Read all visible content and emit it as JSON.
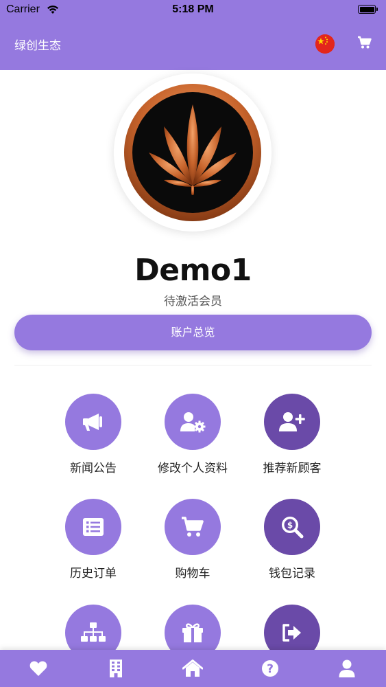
{
  "status_bar": {
    "carrier": "Carrier",
    "time": "5:18 PM"
  },
  "navbar": {
    "title": "绿创生态",
    "flag_icon": "china-flag-icon",
    "cart_icon": "cart-icon"
  },
  "profile": {
    "username": "Demo1",
    "status": "待激活会员",
    "overview_button": "账户总览"
  },
  "menu": [
    {
      "label": "新闻公告",
      "icon": "megaphone-icon"
    },
    {
      "label": "修改个人资料",
      "icon": "user-settings-icon"
    },
    {
      "label": "推荐新顾客",
      "icon": "add-user-icon"
    },
    {
      "label": "历史订单",
      "icon": "list-icon"
    },
    {
      "label": "购物车",
      "icon": "cart-icon"
    },
    {
      "label": "钱包记录",
      "icon": "search-dollar-icon"
    },
    {
      "label": "",
      "icon": "sitemap-icon"
    },
    {
      "label": "",
      "icon": "gift-icon"
    },
    {
      "label": "",
      "icon": "sign-out-icon"
    }
  ],
  "tab_bar": [
    {
      "icon": "heart-icon"
    },
    {
      "icon": "building-icon"
    },
    {
      "icon": "home-icon"
    },
    {
      "icon": "question-icon"
    },
    {
      "icon": "user-icon"
    }
  ],
  "colors": {
    "primary": "#9579df",
    "primary_dark": "#6a4aa8",
    "logo_copper": "#c8642c"
  }
}
